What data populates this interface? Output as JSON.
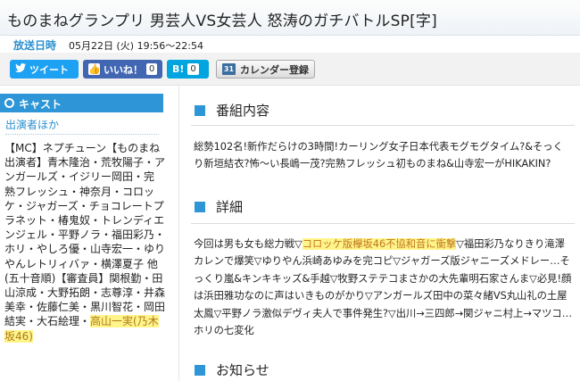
{
  "header": {
    "title": "ものまねグランプリ 男芸人VS女芸人 怒涛のガチバトルSP[字]"
  },
  "airtime": {
    "label": "放送日時",
    "value": "05月22日 (火) 19:56～22:54"
  },
  "share": {
    "tweet_label": "ツイート",
    "like_label": "いいね！",
    "like_count": "0",
    "hatena_label": "B!",
    "hatena_count": "0",
    "calendar_icon_text": "31",
    "calendar_label": "カレンダー登録"
  },
  "sidebar": {
    "cast_title": "キャスト",
    "cast_subtitle": "出演者ほか",
    "cast_text_main": "【MC】ネプチューン【ものまね出演者】青木隆治・荒牧陽子・アンガールズ・イジリー岡田・完熟フレッシュ・神奈月・コロッケ・ジャガーズ・チョコレートプラネット・椿鬼奴・トレンディエンジェル・平野ノラ・福田彩乃・ホリ・やしろ優・山寺宏一・ゆりやんレトリィバァ・横澤夏子 他(五十音順)【審査員】関根勤・田山涼成・大野拓朗・志尊淳・井森美幸・佐藤仁美・黒川智花・岡田結実・大石絵理・",
    "cast_text_highlight": "高山一実(乃木坂46)"
  },
  "sections": {
    "program_title": "番組内容",
    "program_text": "総勢102名!新作だらけの3時間!カーリング女子日本代表モグモグタイム?&そっくり新垣結衣?怖～い長嶋一茂?完熟フレッシュ初ものまね&山寺宏一がHIKAKIN?",
    "detail_title": "詳細",
    "detail_text_before": "今回は男も女も総力戦▽",
    "detail_text_highlight": "コロッケ版欅坂46不協和音に衝撃",
    "detail_text_after": "▽福田彩乃なりきり滝澤カレンで爆笑▽ゆりやん浜崎あゆみを完コピ▽ジャガーズ版ジャニーズメドレー…そっくり嵐&キンキキッズ&手越▽牧野ステテコまさかの大先輩明石家さんま▽必見!顔は浜田雅功なのに声はいきものがかり▽アンガールズ田中の菜々緒VS丸山礼の土屋太鳳▽平野ノラ激似デヴィ夫人で事件発生?▽出川→三四郎→関ジャニ村上→マツコ…ホリの七変化",
    "notice_title": "お知らせ"
  },
  "colors": {
    "accent": "#2e96d6",
    "highlight": "#fff48a"
  }
}
